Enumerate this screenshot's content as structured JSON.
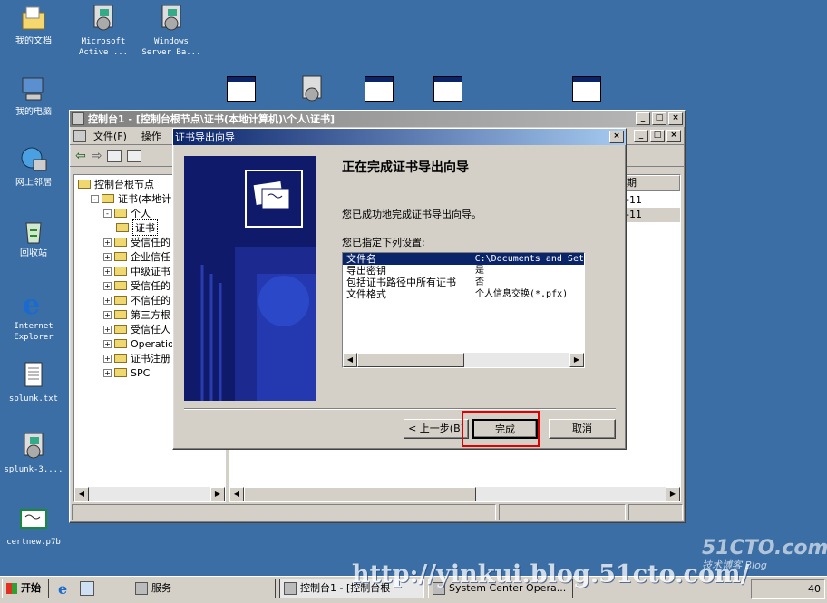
{
  "desktop_icons": [
    {
      "label": "我的文档",
      "icon": "my-documents-icon"
    },
    {
      "label": "Microsoft",
      "label2": "Active ...",
      "icon": "installer-icon"
    },
    {
      "label": "Windows",
      "label2": "Server Ba...",
      "icon": "installer-icon"
    },
    {
      "label": "我的电脑",
      "icon": "my-computer-icon"
    },
    {
      "label": "网上邻居",
      "icon": "network-icon"
    },
    {
      "label": "回收站",
      "icon": "recycle-bin-icon"
    },
    {
      "label": "Internet",
      "label2": "Explorer",
      "icon": "ie-icon"
    },
    {
      "label": "splunk.txt",
      "icon": "text-file-icon"
    },
    {
      "label": "splunk-3....",
      "icon": "installer-icon"
    },
    {
      "label": "certnew.p7b",
      "icon": "certificate-icon"
    }
  ],
  "console": {
    "title": "控制台1 - [控制台根节点\\证书(本地计算机)\\个人\\证书]",
    "menu": [
      "文件(F)",
      "操作"
    ],
    "tree": [
      {
        "label": "控制台根节点",
        "level": 0,
        "exp": ""
      },
      {
        "label": "证书(本地计",
        "level": 1,
        "exp": "-"
      },
      {
        "label": "个人",
        "level": 2,
        "exp": "-"
      },
      {
        "label": "证书",
        "level": 3,
        "exp": ""
      },
      {
        "label": "受信任的",
        "level": 2,
        "exp": "+"
      },
      {
        "label": "企业信任",
        "level": 2,
        "exp": "+"
      },
      {
        "label": "中级证书",
        "level": 2,
        "exp": "+"
      },
      {
        "label": "受信任的",
        "level": 2,
        "exp": "+"
      },
      {
        "label": "不信任的",
        "level": 2,
        "exp": "+"
      },
      {
        "label": "第三方根",
        "level": 2,
        "exp": "+"
      },
      {
        "label": "受信任人",
        "level": 2,
        "exp": "+"
      },
      {
        "label": "Operatio",
        "level": 2,
        "exp": "+"
      },
      {
        "label": "证书注册",
        "level": 2,
        "exp": "+"
      },
      {
        "label": "SPC",
        "level": 2,
        "exp": "+"
      }
    ],
    "list_header": "期",
    "list_rows": [
      "-11",
      "-11"
    ]
  },
  "wizard": {
    "title": "证书导出向导",
    "heading": "正在完成证书导出向导",
    "success_text": "您已成功地完成证书导出向导。",
    "settings_label": "您已指定下列设置:",
    "settings": [
      {
        "key": "文件名",
        "value": "C:\\Documents and Set"
      },
      {
        "key": "导出密钥",
        "value": "是"
      },
      {
        "key": "包括证书路径中所有证书",
        "value": "否"
      },
      {
        "key": "文件格式",
        "value": "个人信息交换(*.pfx)"
      }
    ],
    "back_button": "< 上一步(B)",
    "finish_button": "完成",
    "cancel_button": "取消"
  },
  "taskbar": {
    "start_label": "开始",
    "tasks": [
      "服务",
      "控制台1 - [控制台根",
      "System Center Opera..."
    ]
  },
  "watermark": "http://yinkui.blog.51cto.com/",
  "logo_text": "51CTO.com",
  "logo_sub": "技术博客  Blog",
  "clock": "40",
  "colors": {
    "desktop": "#3a6ea5",
    "title_active": "#0a246a",
    "highlight_box": "#e00000"
  }
}
